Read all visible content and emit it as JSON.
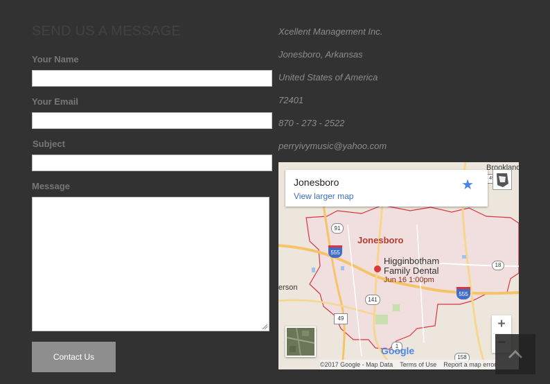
{
  "form": {
    "title": "SEND US A MESSAGE",
    "name_label": "Your Name",
    "email_label": "Your Email",
    "subject_label": "Subject",
    "message_label": "Message",
    "submit_label": "Contact Us"
  },
  "contact": {
    "company": "Xcellent Management Inc.",
    "city": "Jonesboro, Arkansas",
    "country": "United States of America",
    "zip": "72401",
    "phone": "870 - 273 - 2522",
    "email": "perryivymusic@yahoo.com"
  },
  "map": {
    "place_title": "Jonesboro",
    "larger_map_link": "View larger map",
    "city_label": "Jonesboro",
    "poi_name_line1": "Higginbotham",
    "poi_name_line2": "Family Dental",
    "poi_time": "Jun 16 1:00pm",
    "place_top_right": "Brookland",
    "place_left": "erson",
    "route_91": "91",
    "route_555a": "555",
    "route_555b": "555",
    "route_18": "18",
    "route_141": "141",
    "route_49a": "49",
    "route_49b": "49",
    "route_1": "1",
    "route_158": "158",
    "zoom_in": "+",
    "zoom_out": "−",
    "google_logo": "Google",
    "footer_copyright": "©2017 Google - Map Data",
    "footer_terms": "Terms of Use",
    "footer_report": "Report a map error",
    "colors": {
      "city_boundary": "#d9363e",
      "city_fill": "#f1dede",
      "highway": "#f5c469",
      "interstate_shield": "#3f6dc7",
      "link": "#3a6fbf"
    }
  },
  "icons": {
    "star": "★",
    "chevron_up": "chevron-up-icon"
  }
}
